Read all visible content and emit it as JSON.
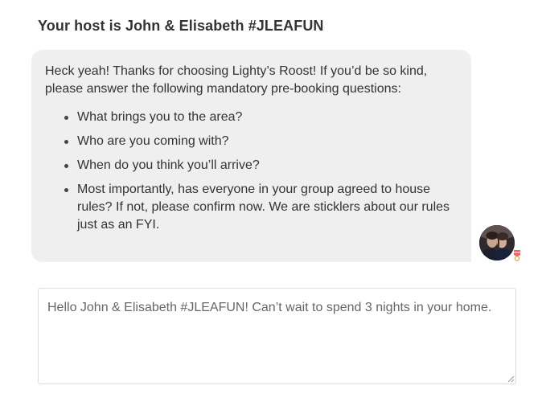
{
  "host": {
    "title": "Your host is John & Elisabeth #JLEAFUN"
  },
  "message": {
    "intro": "Heck yeah! Thanks for choosing Lighty’s Roost! If you’d be so kind, please answer the following mandatory pre-booking questions:",
    "questions": [
      "What brings you to the area?",
      "Who are you coming with?",
      "When do you think you’ll arrive?",
      "Most importantly, has everyone in your group agreed to house rules? If not, please confirm now. We are sticklers about our rules just as an FYI."
    ]
  },
  "compose": {
    "value": "Hello John & Elisabeth #JLEAFUN! Can’t wait to spend 3 nights in your home."
  },
  "colors": {
    "bubble": "#efefef",
    "text": "#333333",
    "border": "#dddddd",
    "badge": "#ff5a5f"
  }
}
